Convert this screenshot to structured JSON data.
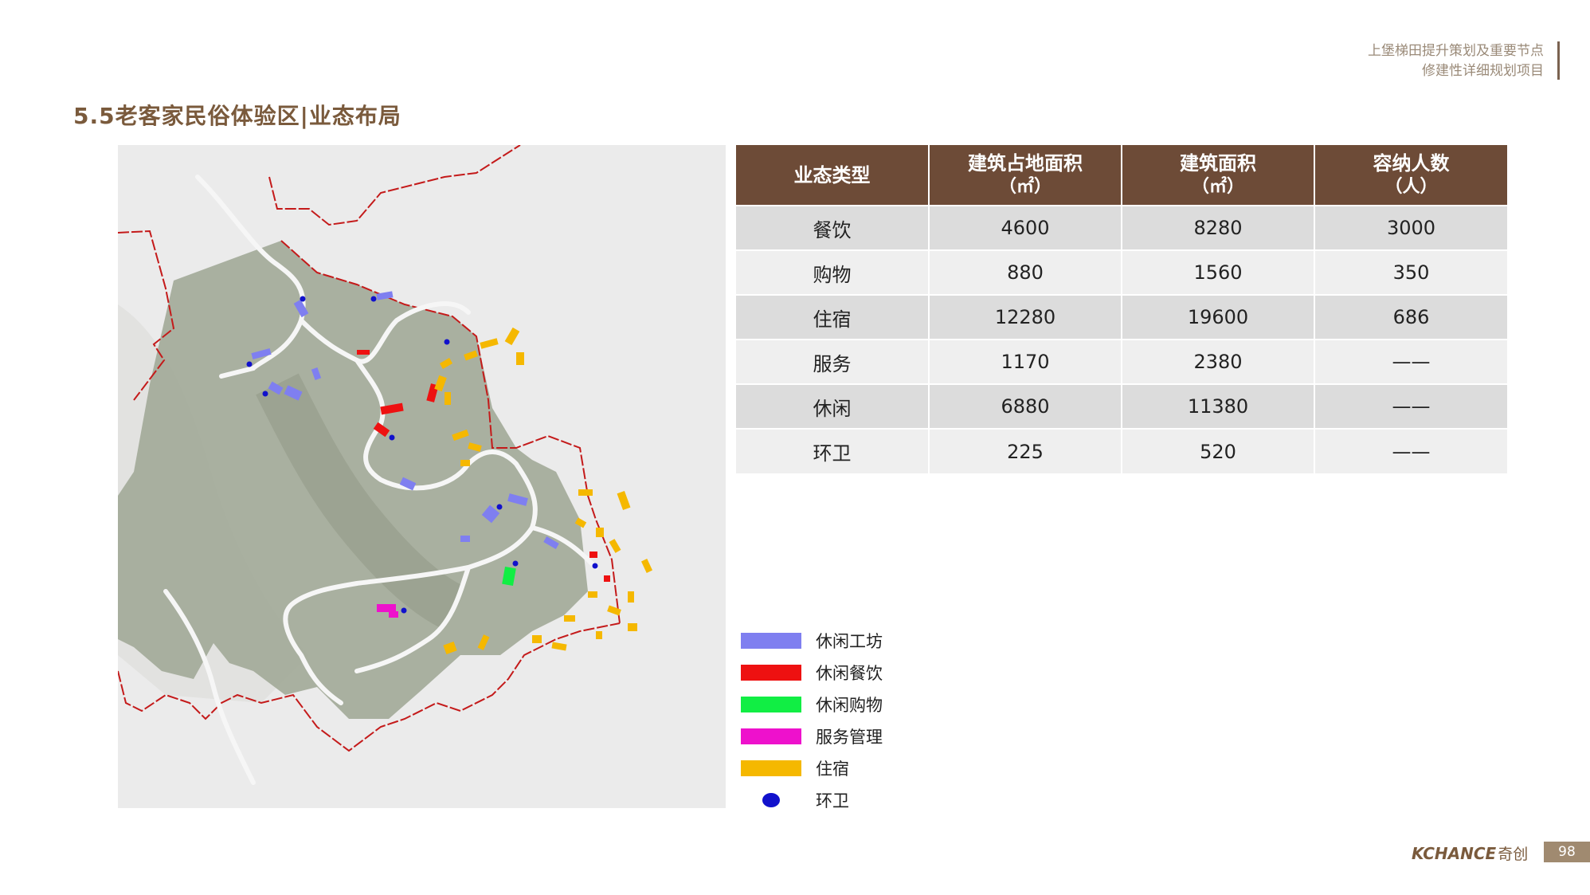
{
  "header": {
    "project_line1": "上堡梯田提升策划及重要节点",
    "project_line2": "修建性详细规划项目"
  },
  "title": "5.5老客家民俗体验区|业态布局",
  "table": {
    "headers": [
      {
        "label": "业态类型",
        "unit": ""
      },
      {
        "label": "建筑占地面积",
        "unit": "（㎡）"
      },
      {
        "label": "建筑面积",
        "unit": "（㎡）"
      },
      {
        "label": "容纳人数",
        "unit": "（人）"
      }
    ],
    "rows": [
      {
        "type": "餐饮",
        "footprint": "4600",
        "area": "8280",
        "capacity": "3000"
      },
      {
        "type": "购物",
        "footprint": "880",
        "area": "1560",
        "capacity": "350"
      },
      {
        "type": "住宿",
        "footprint": "12280",
        "area": "19600",
        "capacity": "686"
      },
      {
        "type": "服务",
        "footprint": "1170",
        "area": "2380",
        "capacity": "——"
      },
      {
        "type": "休闲",
        "footprint": "6880",
        "area": "11380",
        "capacity": "——"
      },
      {
        "type": "环卫",
        "footprint": "225",
        "area": "520",
        "capacity": "——"
      }
    ]
  },
  "legend": [
    {
      "label": "休闲工坊",
      "color": "#7f7ff0",
      "shape": "rect"
    },
    {
      "label": "休闲餐饮",
      "color": "#ee1111",
      "shape": "rect"
    },
    {
      "label": "休闲购物",
      "color": "#11ee44",
      "shape": "rect"
    },
    {
      "label": "服务管理",
      "color": "#ee11cc",
      "shape": "rect"
    },
    {
      "label": "住宿",
      "color": "#f5b800",
      "shape": "rect"
    },
    {
      "label": "环卫",
      "color": "#1111cc",
      "shape": "dot"
    }
  ],
  "footer": {
    "brand": "KCHANCE",
    "brand_cn": "奇创",
    "page": "98"
  }
}
